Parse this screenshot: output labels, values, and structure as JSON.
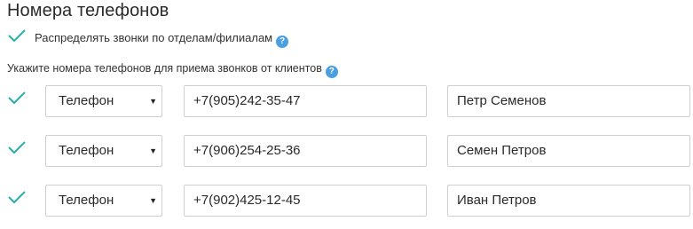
{
  "section_title": "Номера телефонов",
  "distribute": {
    "label": "Распределять звонки по отделам/филиалам",
    "checked": true,
    "help_icon": "?"
  },
  "instructions": {
    "label": "Укажите номера телефонов для приема звонков от клиентов",
    "help_icon": "?"
  },
  "colors": {
    "check": "#26b1a7",
    "help": "#4a9fe0",
    "border": "#cfcfcf"
  },
  "phones": [
    {
      "checked": true,
      "type": "Телефон",
      "number": "+7(905)242-35-47",
      "name": "Петр Семенов"
    },
    {
      "checked": true,
      "type": "Телефон",
      "number": "+7(906)254-25-36",
      "name": "Семен Петров"
    },
    {
      "checked": true,
      "type": "Телефон",
      "number": "+7(902)425-12-45",
      "name": "Иван Петров"
    }
  ]
}
